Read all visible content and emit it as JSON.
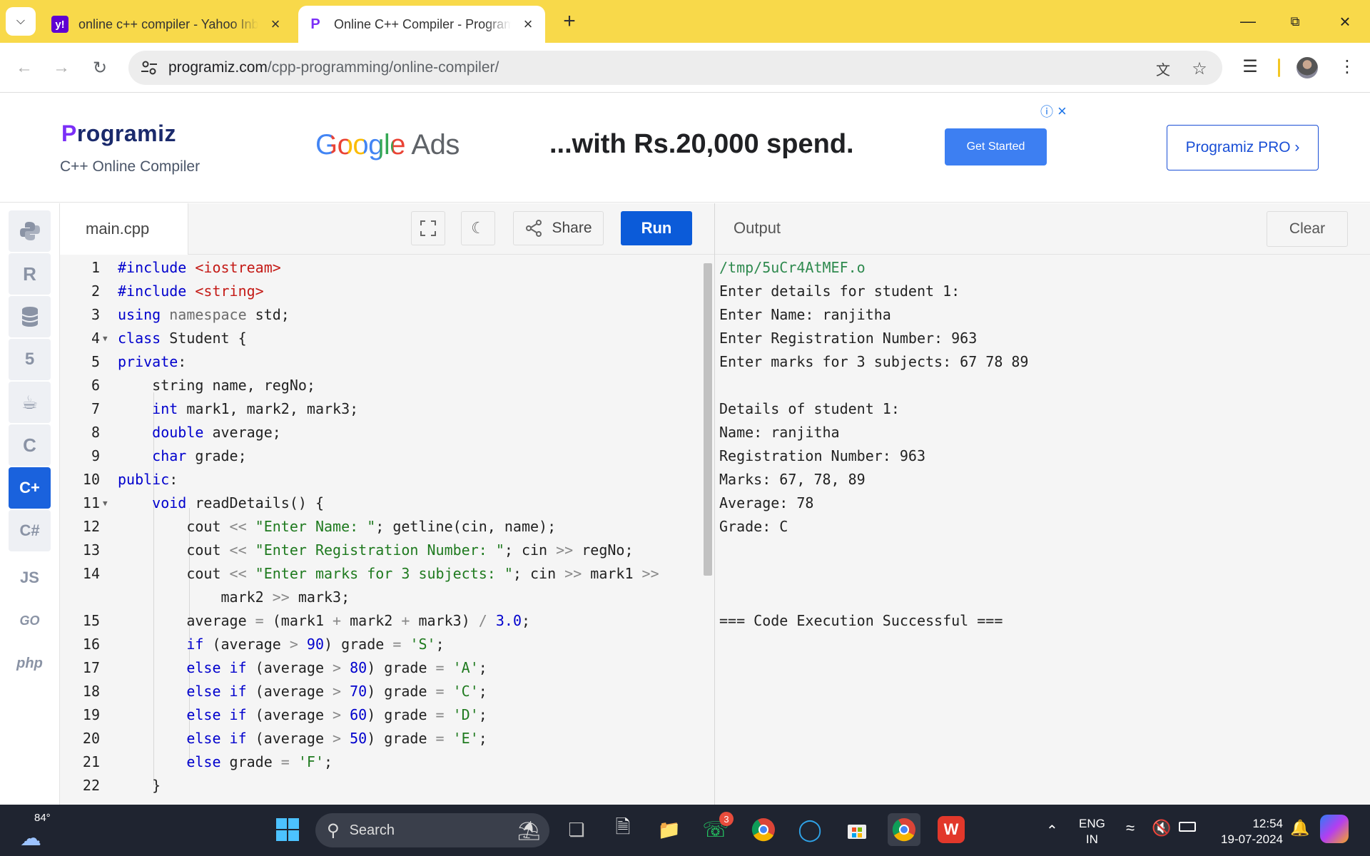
{
  "browser": {
    "tabs": [
      {
        "title": "online c++ compiler - Yahoo Inbox",
        "favicon": "yahoo-icon"
      },
      {
        "title": "Online C++ Compiler - Programiz",
        "favicon": "programiz-icon"
      }
    ],
    "url_host": "programiz.com",
    "url_path": "/cpp-programming/online-compiler/"
  },
  "header": {
    "logo_rest": "rogramiz",
    "logo_p": "P",
    "subtitle": "C++ Online Compiler",
    "ad_google": "Google",
    "ad_ads": "Ads",
    "ad_text": "...with Rs.20,000 spend.",
    "ad_button": "Get Started",
    "pro_button": "Programiz PRO ›"
  },
  "rail": [
    "python-icon",
    "r-icon",
    "sql-icon",
    "html5-icon",
    "java-icon",
    "c-icon",
    "cpp-icon",
    "csharp-icon",
    "js-icon",
    "go-icon",
    "php-icon"
  ],
  "rail_labels": {
    "js": "JS",
    "go": "GO",
    "php": "php"
  },
  "editor": {
    "filename": "main.cpp",
    "share_label": "Share",
    "run_label": "Run"
  },
  "code": [
    {
      "n": "1",
      "fold": false
    },
    {
      "n": "2",
      "fold": false
    },
    {
      "n": "3",
      "fold": false
    },
    {
      "n": "4",
      "fold": true
    },
    {
      "n": "5",
      "fold": false
    },
    {
      "n": "6",
      "fold": false
    },
    {
      "n": "7",
      "fold": false
    },
    {
      "n": "8",
      "fold": false
    },
    {
      "n": "9",
      "fold": false
    },
    {
      "n": "10",
      "fold": false
    },
    {
      "n": "11",
      "fold": true
    },
    {
      "n": "12",
      "fold": false
    },
    {
      "n": "13",
      "fold": false
    },
    {
      "n": "14",
      "fold": false
    },
    {
      "n": "",
      "fold": false
    },
    {
      "n": "15",
      "fold": false
    },
    {
      "n": "16",
      "fold": false
    },
    {
      "n": "17",
      "fold": false
    },
    {
      "n": "18",
      "fold": false
    },
    {
      "n": "19",
      "fold": false
    },
    {
      "n": "20",
      "fold": false
    },
    {
      "n": "21",
      "fold": false
    },
    {
      "n": "22",
      "fold": false
    }
  ],
  "code_tokens": [
    [
      [
        "kw",
        "#include "
      ],
      [
        "str",
        "<iostream>"
      ]
    ],
    [
      [
        "kw",
        "#include "
      ],
      [
        "str",
        "<string>"
      ]
    ],
    [
      [
        "kw",
        "using "
      ],
      [
        "ns",
        "namespace "
      ],
      [
        "",
        "std;"
      ]
    ],
    [
      [
        "kw",
        "class "
      ],
      [
        "",
        "Student {"
      ]
    ],
    [
      [
        "kw",
        "private"
      ],
      [
        "",
        ":"
      ]
    ],
    [
      [
        "",
        "    string name, regNo;"
      ]
    ],
    [
      [
        "",
        "    "
      ],
      [
        "kw",
        "int "
      ],
      [
        "",
        "mark1, mark2, mark3;"
      ]
    ],
    [
      [
        "",
        "    "
      ],
      [
        "kw",
        "double "
      ],
      [
        "",
        "average;"
      ]
    ],
    [
      [
        "",
        "    "
      ],
      [
        "kw",
        "char "
      ],
      [
        "",
        "grade;"
      ]
    ],
    [
      [
        "kw",
        "public"
      ],
      [
        "",
        ":"
      ]
    ],
    [
      [
        "",
        "    "
      ],
      [
        "kw",
        "void "
      ],
      [
        "",
        "readDetails() {"
      ]
    ],
    [
      [
        "",
        "        cout "
      ],
      [
        "op",
        "<< "
      ],
      [
        "strg",
        "\"Enter Name: \""
      ],
      [
        "",
        "; getline(cin, name);"
      ]
    ],
    [
      [
        "",
        "        cout "
      ],
      [
        "op",
        "<< "
      ],
      [
        "strg",
        "\"Enter Registration Number: \""
      ],
      [
        "",
        "; cin "
      ],
      [
        "op",
        ">> "
      ],
      [
        "",
        "regNo;"
      ]
    ],
    [
      [
        "",
        "        cout "
      ],
      [
        "op",
        "<< "
      ],
      [
        "strg",
        "\"Enter marks for 3 subjects: \""
      ],
      [
        "",
        "; cin "
      ],
      [
        "op",
        ">> "
      ],
      [
        "",
        "mark1 "
      ],
      [
        "op",
        ">>"
      ]
    ],
    [
      [
        "",
        "            mark2 "
      ],
      [
        "op",
        ">> "
      ],
      [
        "",
        "mark3;"
      ]
    ],
    [
      [
        "",
        "        average "
      ],
      [
        "op",
        "= "
      ],
      [
        "",
        "(mark1 "
      ],
      [
        "op",
        "+ "
      ],
      [
        "",
        "mark2 "
      ],
      [
        "op",
        "+ "
      ],
      [
        "",
        "mark3) "
      ],
      [
        "op",
        "/ "
      ],
      [
        "numlit",
        "3.0"
      ],
      [
        "",
        ";"
      ]
    ],
    [
      [
        "",
        "        "
      ],
      [
        "kw",
        "if "
      ],
      [
        "",
        "(average "
      ],
      [
        "op",
        "> "
      ],
      [
        "numlit",
        "90"
      ],
      [
        "",
        ") grade "
      ],
      [
        "op",
        "= "
      ],
      [
        "strg",
        "'S'"
      ],
      [
        "",
        ";"
      ]
    ],
    [
      [
        "",
        "        "
      ],
      [
        "kw",
        "else if "
      ],
      [
        "",
        "(average "
      ],
      [
        "op",
        "> "
      ],
      [
        "numlit",
        "80"
      ],
      [
        "",
        ") grade "
      ],
      [
        "op",
        "= "
      ],
      [
        "strg",
        "'A'"
      ],
      [
        "",
        ";"
      ]
    ],
    [
      [
        "",
        "        "
      ],
      [
        "kw",
        "else if "
      ],
      [
        "",
        "(average "
      ],
      [
        "op",
        "> "
      ],
      [
        "numlit",
        "70"
      ],
      [
        "",
        ") grade "
      ],
      [
        "op",
        "= "
      ],
      [
        "strg",
        "'C'"
      ],
      [
        "",
        ";"
      ]
    ],
    [
      [
        "",
        "        "
      ],
      [
        "kw",
        "else if "
      ],
      [
        "",
        "(average "
      ],
      [
        "op",
        "> "
      ],
      [
        "numlit",
        "60"
      ],
      [
        "",
        ") grade "
      ],
      [
        "op",
        "= "
      ],
      [
        "strg",
        "'D'"
      ],
      [
        "",
        ";"
      ]
    ],
    [
      [
        "",
        "        "
      ],
      [
        "kw",
        "else if "
      ],
      [
        "",
        "(average "
      ],
      [
        "op",
        "> "
      ],
      [
        "numlit",
        "50"
      ],
      [
        "",
        ") grade "
      ],
      [
        "op",
        "= "
      ],
      [
        "strg",
        "'E'"
      ],
      [
        "",
        ";"
      ]
    ],
    [
      [
        "",
        "        "
      ],
      [
        "kw",
        "else "
      ],
      [
        "",
        "grade "
      ],
      [
        "op",
        "= "
      ],
      [
        "strg",
        "'F'"
      ],
      [
        "",
        ";"
      ]
    ],
    [
      [
        "",
        "    }"
      ]
    ]
  ],
  "output": {
    "title": "Output",
    "clear_label": "Clear",
    "lines": [
      "/tmp/5uCr4AtMEF.o",
      "Enter details for student 1:",
      "Enter Name: ranjitha",
      "Enter Registration Number: 963",
      "Enter marks for 3 subjects: 67 78 89",
      "",
      "Details of student 1:",
      "Name: ranjitha",
      "Registration Number: 963",
      "Marks: 67, 78, 89",
      "Average: 78",
      "Grade: C",
      "",
      "",
      "",
      "=== Code Execution Successful ==="
    ]
  },
  "taskbar": {
    "weather": "84°",
    "search": "Search",
    "whatsapp_badge": "3",
    "lang_top": "ENG",
    "lang_bottom": "IN",
    "time": "12:54",
    "date": "19-07-2024"
  },
  "colors": {
    "accent": "#0b5bd9",
    "tabstrip": "#f8d94a",
    "active_rail": "#1a62dd"
  }
}
